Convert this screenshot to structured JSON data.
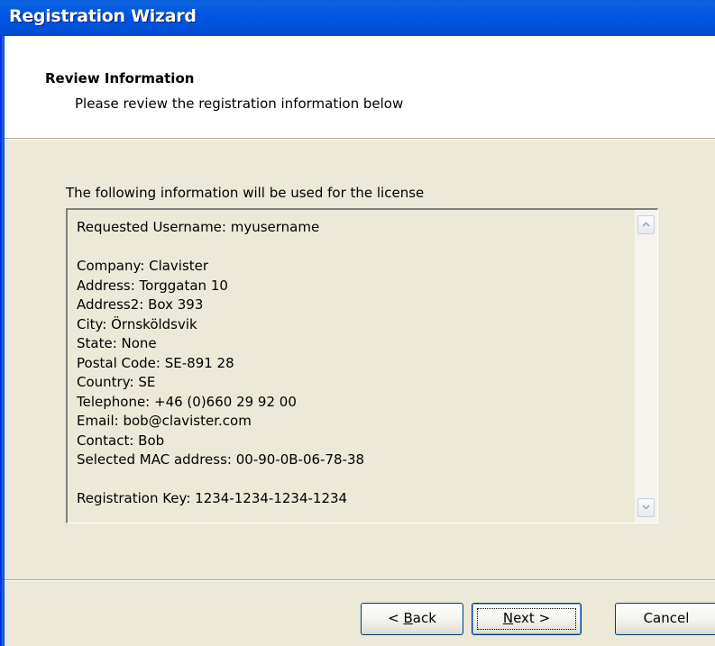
{
  "window": {
    "title": "Registration Wizard"
  },
  "header": {
    "title": "Review Information",
    "subtitle": "Please review the registration information below"
  },
  "content": {
    "label": "The following information will be used for the license",
    "lines": [
      "Requested Username: myusername",
      "",
      "Company: Clavister",
      "Address: Torggatan 10",
      "Address2: Box 393",
      "City: Örnsköldsvik",
      "State: None",
      "Postal Code: SE-891 28",
      "Country: SE",
      "Telephone: +46 (0)660 29 92 00",
      "Email: bob@clavister.com",
      "Contact: Bob",
      "Selected MAC address: 00-90-0B-06-78-38",
      "",
      "Registration Key: 1234-1234-1234-1234"
    ]
  },
  "buttons": {
    "back": {
      "prefix": "< ",
      "mnemonic": "B",
      "rest": "ack"
    },
    "next": {
      "mnemonic": "N",
      "rest": "ext >"
    },
    "cancel": "Cancel"
  },
  "colors": {
    "titlebar": "#0054e3",
    "dialog_bg": "#ece9d8",
    "header_bg": "#ffffff"
  }
}
